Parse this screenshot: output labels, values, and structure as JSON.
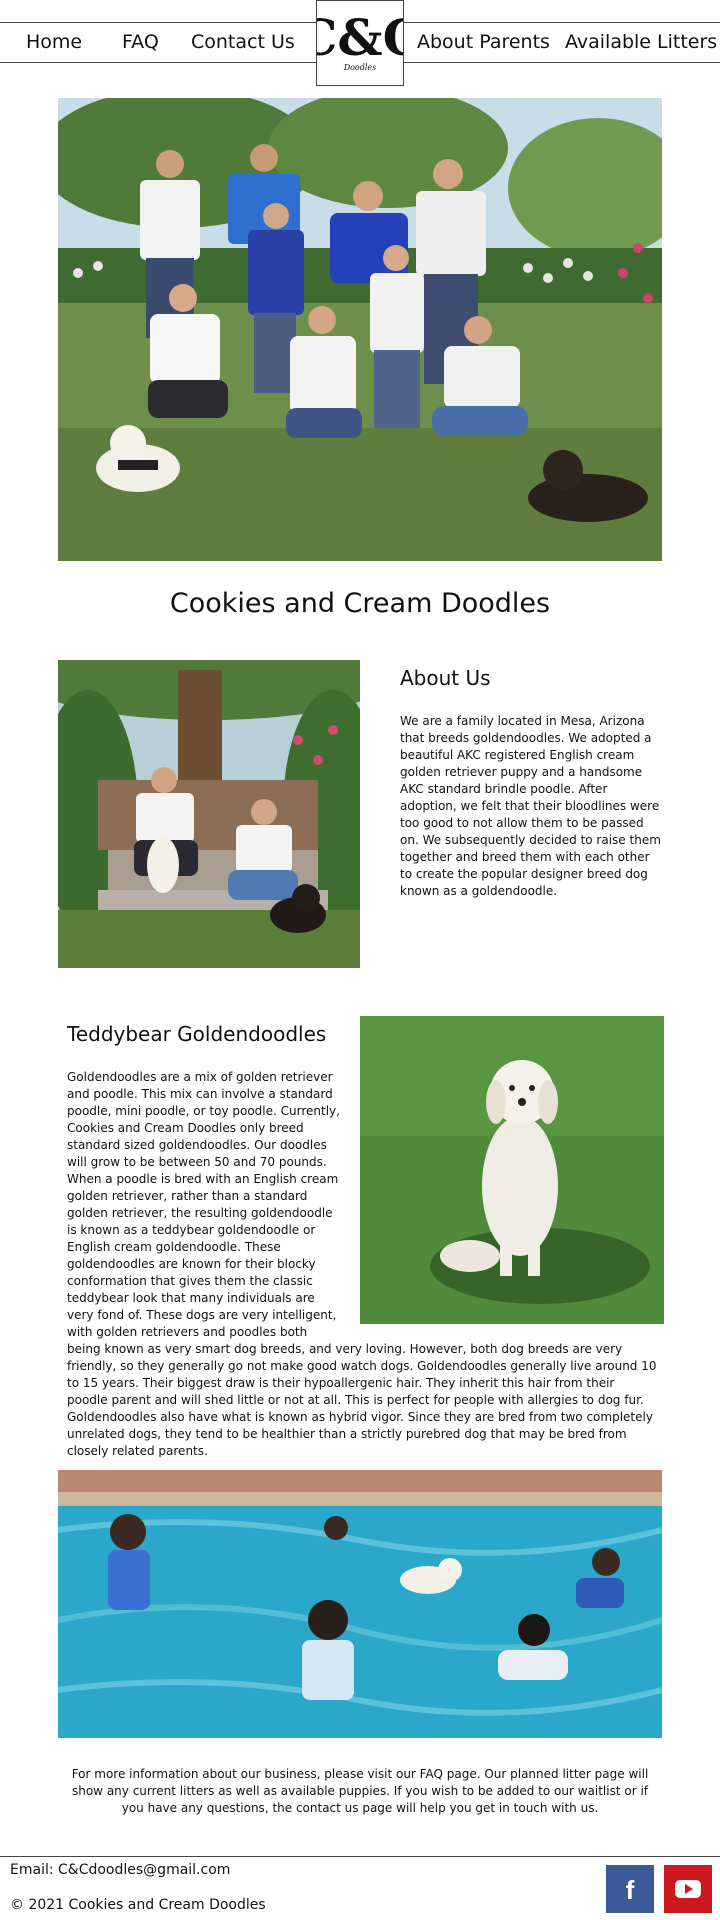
{
  "nav": {
    "links": [
      "Home",
      "FAQ",
      "Contact Us",
      "About Parents",
      "Available Litters"
    ],
    "logo": {
      "mark": "C&C",
      "subtitle": "Doodles"
    }
  },
  "hero": {
    "alt": "Family group photo with two dogs on a lawn"
  },
  "site_title": "Cookies and Cream Doodles",
  "about": {
    "heading": "About Us",
    "text": "We are a family located in Mesa, Arizona that breeds goldendoodles. We adopted a beautiful AKC registered English cream golden retriever puppy and a handsome AKC standard brindle poodle. After adoption, we felt that their bloodlines were too good to not allow them to be passed on. We subsequently decided to raise them together and breed them with each other to create the popular designer breed dog known as a goldendoodle."
  },
  "teddy": {
    "heading": "Teddybear Goldendoodles",
    "text": "Goldendoodles are a mix of golden retriever and poodle. This mix can involve a standard poodle, mini poodle, or toy poodle. Currently, Cookies and Cream Doodles only breed standard sized goldendoodles. Our doodles will grow to be between 50 and 70 pounds. When a poodle is bred with an English cream golden retriever, rather than a standard golden retriever, the resulting goldendoodle is known as a teddybear goldendoodle or English cream goldendoodle. These goldendoodles are known for their blocky conformation that gives them the classic teddybear look that many individuals are very fond of. These dogs are very intelligent, with golden retrievers and poodles both being known as very smart dog breeds, and very loving. However, both dog breeds are very friendly, so they generally go not make good watch dogs. Goldendoodles generally live around 10 to 15 years. Their biggest draw is their hypoallergenic hair. They inherit this hair from their poodle parent and will shed little or not at all. This is perfect for people with allergies to dog fur. Goldendoodles also have what is known as hybrid vigor. Since they are bred from two completely unrelated dogs, they tend to be healthier than a strictly purebred dog that may be bred from closely related parents."
  },
  "closing": "For more information about our business, please visit our FAQ page. Our planned litter page will show any current litters as well as available puppies. If you wish to be added to our waitlist or if you have any questions, the contact us page will help you get in touch with us.",
  "footer": {
    "email": "Email: C&Cdoodles@gmail.com",
    "copyright": "© 2021 Cookies and Cream Doodles",
    "social": [
      {
        "label": "f",
        "icon": "facebook-icon",
        "color": "#3b5998"
      },
      {
        "label": "youtube",
        "icon": "youtube-icon",
        "color": "#cc181e"
      }
    ]
  }
}
